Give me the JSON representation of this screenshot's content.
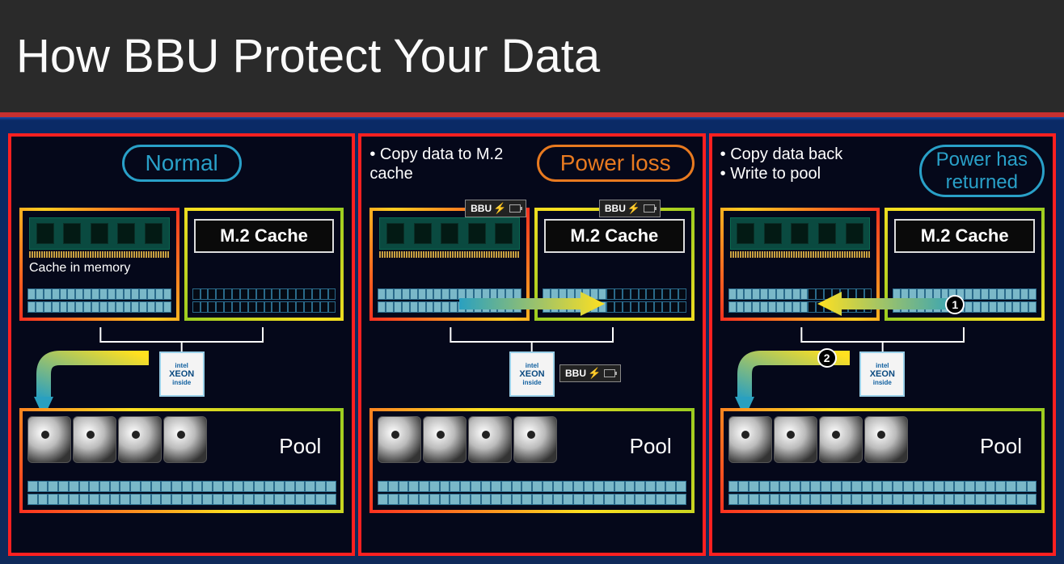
{
  "title": "How BBU Protect Your Data",
  "labels": {
    "m2_cache": "M.2 Cache",
    "cache_in_memory": "Cache in memory",
    "pool": "Pool",
    "bbu": "BBU",
    "cpu_brand": "intel",
    "cpu_name": "XEON",
    "cpu_sub": "inside"
  },
  "panels": [
    {
      "state": "Normal",
      "state_style": "normal",
      "notes": [],
      "show_mem_caption": true,
      "bbu_on_modules": false,
      "bbu_on_cpu": false,
      "arrow": "mem_to_pool",
      "mem_fill": "full",
      "m2_fill": "empty",
      "steps": []
    },
    {
      "state": "Power loss",
      "state_style": "powerloss",
      "notes": [
        "Copy data to M.2 cache"
      ],
      "show_mem_caption": false,
      "bbu_on_modules": true,
      "bbu_on_cpu": true,
      "arrow": "mem_to_m2",
      "mem_fill": "full",
      "m2_fill": "partial",
      "steps": []
    },
    {
      "state": "Power has returned",
      "state_style": "returned",
      "notes": [
        "Copy data back",
        "Write to pool"
      ],
      "show_mem_caption": false,
      "bbu_on_modules": false,
      "bbu_on_cpu": false,
      "arrow": "m2_to_mem_and_pool",
      "mem_fill": "partial",
      "m2_fill": "full",
      "steps": [
        1,
        2
      ]
    }
  ]
}
